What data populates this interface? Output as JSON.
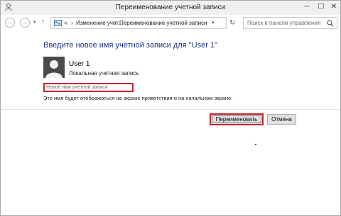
{
  "window": {
    "title": "Переименование учетной записи"
  },
  "titlebar_controls": {
    "minimize_glyph": "─",
    "maximize_glyph": "☐",
    "close_glyph": "✕"
  },
  "nav": {
    "back_glyph": "←",
    "forward_glyph": "→",
    "history_glyph": "▾",
    "up_glyph": "↑",
    "refresh_glyph": "↻"
  },
  "address": {
    "overflow": "«",
    "crumbs": [
      "Изменение учет...",
      "Переименование учетной записи"
    ],
    "separator": "›",
    "dropdown_glyph": "▾"
  },
  "search": {
    "placeholder": "Поиск в панели управления"
  },
  "content": {
    "heading": "Введите новое имя учетной записи для \"User 1\"",
    "user_name": "User 1",
    "user_type": "Локальная учетная запись",
    "new_name_placeholder": "Новое имя учетной записи",
    "hint": "Это имя будет отображаться на экране приветствия и на начальном экране."
  },
  "buttons": {
    "rename": "Переименовать",
    "cancel": "Отмена"
  },
  "colors": {
    "heading": "#1e3287",
    "highlight": "#c0272d",
    "avatar_bg": "#4a4a4a"
  },
  "icons": [
    "user-accounts-icon",
    "control-panel-icon",
    "search-icon",
    "avatar-silhouette-icon"
  ]
}
